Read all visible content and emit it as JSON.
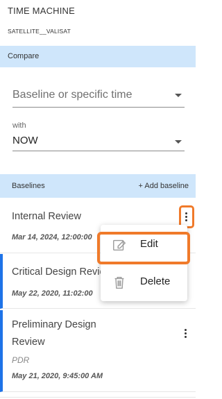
{
  "header": {
    "title": "TIME MACHINE",
    "subtitle": "SATELLITE__VALISAT"
  },
  "compare": {
    "section_label": "Compare",
    "baseline_select": {
      "value": "Baseline or specific time"
    },
    "with_label": "with",
    "target_select": {
      "value": "NOW"
    }
  },
  "baselines": {
    "section_label": "Baselines",
    "add_label": "+ Add baseline",
    "items": [
      {
        "name": "Internal Review",
        "date": "Mar 14, 2024, 12:00:00",
        "active": false
      },
      {
        "name": "Critical Design Review",
        "date": "May 22, 2020, 11:02:00",
        "active": true
      },
      {
        "name_line1": "Preliminary Design",
        "name_line2": "Review",
        "code": "PDR",
        "date": "May 21, 2020, 9:45:00 AM",
        "active": true
      }
    ]
  },
  "context_menu": {
    "items": [
      {
        "label": "Edit",
        "icon": "edit-icon"
      },
      {
        "label": "Delete",
        "icon": "trash-icon"
      }
    ]
  },
  "colors": {
    "accent": "#1e73e8",
    "section_bg": "#cfe6fb",
    "highlight": "#f07a2a"
  }
}
